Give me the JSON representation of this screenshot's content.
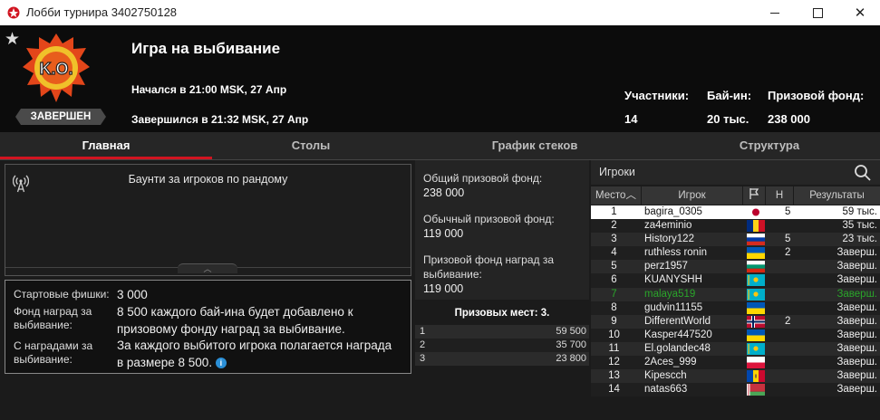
{
  "window": {
    "title": "Лобби турнира 3402750128"
  },
  "header": {
    "tournament_name": "Игра на выбивание",
    "badge_text": "K.O.",
    "status": "ЗАВЕРШЕН",
    "started": "Начался в 21:00 MSK, 27 Апр",
    "finished": "Завершился в 21:32 MSK, 27 Апр",
    "stats": [
      {
        "label": "Участники:",
        "value": "14"
      },
      {
        "label": "Бай-ин:",
        "value": "20 тыс."
      },
      {
        "label": "Призовой фонд:",
        "value": "238 000"
      }
    ]
  },
  "tabs": [
    {
      "label": "Главная",
      "active": true
    },
    {
      "label": "Столы"
    },
    {
      "label": "График стеков"
    },
    {
      "label": "Структура"
    }
  ],
  "info": {
    "bounty_text": "Баунти за игроков по рандому",
    "details": [
      {
        "key": "Стартовые фишки:",
        "value": "3 000"
      },
      {
        "key": "Фонд наград за выбивание:",
        "value": "8 500 каждого бай-ина будет добавлено к призовому фонду наград за выбивание."
      },
      {
        "key": "С наградами за выбивание:",
        "value": "За каждого выбитого игрока полагается награда в размере 8 500."
      }
    ]
  },
  "prize_pool": {
    "total_label": "Общий призовой фонд:",
    "total_value": "238 000",
    "regular_label": "Обычный призовой фонд:",
    "regular_value": "119 000",
    "bounty_label": "Призовой фонд наград за выбивание:",
    "bounty_value": "119 000",
    "places_title": "Призовых мест: 3.",
    "places": [
      {
        "place": "1",
        "amount": "59 500"
      },
      {
        "place": "2",
        "amount": "35 700"
      },
      {
        "place": "3",
        "amount": "23 800"
      }
    ]
  },
  "players": {
    "search_label": "Игроки",
    "columns": {
      "place": "Место",
      "name": "Игрок",
      "knockouts": "Н",
      "results": "Результаты"
    },
    "rows": [
      {
        "place": "1",
        "name": "bagira_0305",
        "flag": "japan",
        "knockouts": "5",
        "result": "59 тыс."
      },
      {
        "place": "2",
        "name": "za4eminio",
        "flag": "romania",
        "knockouts": "",
        "result": "35 тыс."
      },
      {
        "place": "3",
        "name": "History122",
        "flag": "russia",
        "knockouts": "5",
        "result": "23 тыс."
      },
      {
        "place": "4",
        "name": "ruthless ronin",
        "flag": "ukraine",
        "knockouts": "2",
        "result": "Заверш."
      },
      {
        "place": "5",
        "name": "perz1957",
        "flag": "bulgaria",
        "knockouts": "",
        "result": "Заверш."
      },
      {
        "place": "6",
        "name": "KUANYSHH",
        "flag": "kazakhstan",
        "knockouts": "",
        "result": "Заверш."
      },
      {
        "place": "7",
        "name": "malaya519",
        "flag": "kazakhstan",
        "knockouts": "",
        "result": "Заверш."
      },
      {
        "place": "8",
        "name": "gudvin11155",
        "flag": "ukraine",
        "knockouts": "",
        "result": "Заверш."
      },
      {
        "place": "9",
        "name": "DifferentWorld",
        "flag": "norway",
        "knockouts": "2",
        "result": "Заверш."
      },
      {
        "place": "10",
        "name": "Kasper447520",
        "flag": "ukraine",
        "knockouts": "",
        "result": "Заверш."
      },
      {
        "place": "11",
        "name": "El.golandec48",
        "flag": "kazakhstan",
        "knockouts": "",
        "result": "Заверш."
      },
      {
        "place": "12",
        "name": "2Aces_999",
        "flag": "poland",
        "knockouts": "",
        "result": "Заверш."
      },
      {
        "place": "13",
        "name": "Kipescch",
        "flag": "moldova",
        "knockouts": "",
        "result": "Заверш."
      },
      {
        "place": "14",
        "name": "natas663",
        "flag": "belarus",
        "knockouts": "",
        "result": "Заверш."
      }
    ]
  },
  "colors": {
    "accent": "#d11420",
    "eliminated_text": "#2aa52a",
    "info_icon": "#2b8fd6"
  }
}
